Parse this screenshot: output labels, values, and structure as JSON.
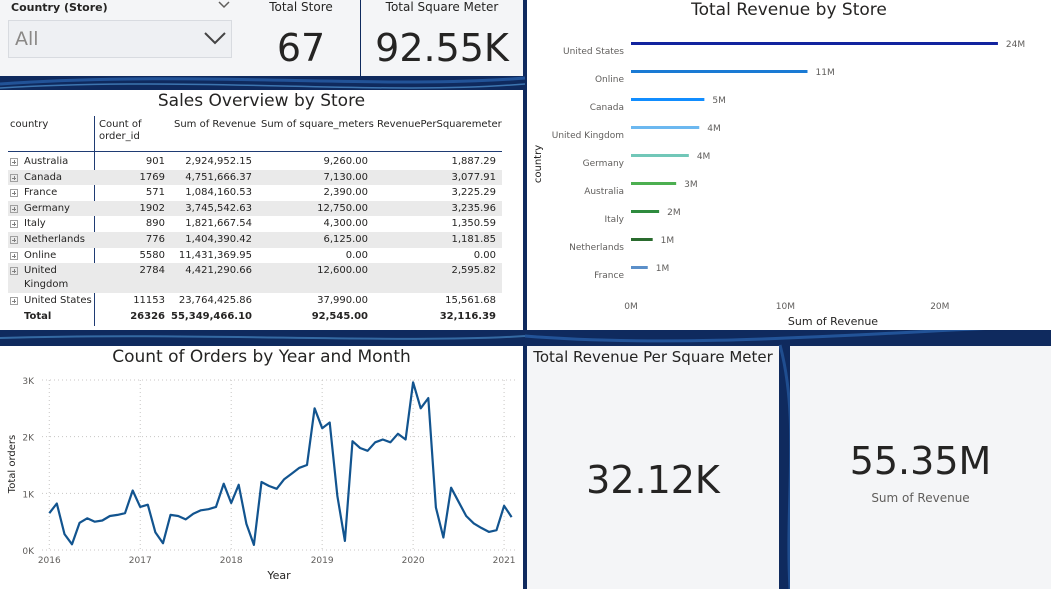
{
  "slicer": {
    "title": "Country (Store)",
    "value": "All"
  },
  "cards": {
    "total_store": {
      "title": "Total Store",
      "value": "67"
    },
    "total_square_meter": {
      "title": "Total Square Meter",
      "value": "92.55K"
    },
    "revenue_per_sqm": {
      "title": "Total Revenue Per Square Meter",
      "value": "32.12K"
    },
    "sum_revenue": {
      "value": "55.35M",
      "label": "Sum of Revenue"
    }
  },
  "table": {
    "title": "Sales Overview by Store",
    "headers": [
      "country",
      "Count of order_id",
      "Sum of Revenue",
      "Sum of square_meters",
      "RevenuePerSquaremeter"
    ],
    "header_lines": {
      "country": "country",
      "count1": "Count of",
      "count2": "order_id",
      "revenue": "Sum of Revenue",
      "sqm": "Sum of square_meters",
      "rpsm": "RevenuePerSquaremeter"
    },
    "rows": [
      {
        "country": "Australia",
        "count": "901",
        "revenue": "2,924,952.15",
        "sqm": "9,260.00",
        "rpsm": "1,887.29"
      },
      {
        "country": "Canada",
        "count": "1769",
        "revenue": "4,751,666.37",
        "sqm": "7,130.00",
        "rpsm": "3,077.91"
      },
      {
        "country": "France",
        "count": "571",
        "revenue": "1,084,160.53",
        "sqm": "2,390.00",
        "rpsm": "3,225.29"
      },
      {
        "country": "Germany",
        "count": "1902",
        "revenue": "3,745,542.63",
        "sqm": "12,750.00",
        "rpsm": "3,235.96"
      },
      {
        "country": "Italy",
        "count": "890",
        "revenue": "1,821,667.54",
        "sqm": "4,300.00",
        "rpsm": "1,350.59"
      },
      {
        "country": "Netherlands",
        "count": "776",
        "revenue": "1,404,390.42",
        "sqm": "6,125.00",
        "rpsm": "1,181.85"
      },
      {
        "country": "Online",
        "count": "5580",
        "revenue": "11,431,369.95",
        "sqm": "0.00",
        "rpsm": "0.00"
      },
      {
        "country": "United",
        "country2": "Kingdom",
        "count": "2784",
        "revenue": "4,421,290.66",
        "sqm": "12,600.00",
        "rpsm": "2,595.82"
      },
      {
        "country": "United States",
        "count": "11153",
        "revenue": "23,764,425.86",
        "sqm": "37,990.00",
        "rpsm": "15,561.68"
      }
    ],
    "total": {
      "label": "Total",
      "count": "26326",
      "revenue": "55,349,466.10",
      "sqm": "92,545.00",
      "rpsm": "32,116.39"
    }
  },
  "chart_data": [
    {
      "type": "bar",
      "orientation": "horizontal",
      "title": "Total Revenue by Store",
      "xlabel": "Sum of Revenue",
      "ylabel": "country",
      "xlim": [
        0,
        25000000
      ],
      "x_ticks": [
        "0M",
        "10M",
        "20M"
      ],
      "x_tick_values": [
        0,
        10000000,
        20000000
      ],
      "categories": [
        "United States",
        "Online",
        "Canada",
        "United Kingdom",
        "Germany",
        "Australia",
        "Italy",
        "Netherlands",
        "France"
      ],
      "values": [
        23764425.86,
        11431369.95,
        4751666.37,
        4421290.66,
        3745542.63,
        2924952.15,
        1821667.54,
        1404390.42,
        1084160.53
      ],
      "data_labels": [
        "24M",
        "11M",
        "5M",
        "4M",
        "4M",
        "3M",
        "2M",
        "1M",
        "1M"
      ],
      "colors": [
        "#12239e",
        "#1a7ad4",
        "#118dff",
        "#6cb8f0",
        "#71c7b8",
        "#4caf50",
        "#2e8b3e",
        "#2a6b2e",
        "#5b8fc9"
      ],
      "grid": false
    },
    {
      "type": "line",
      "title": "Count of Orders by Year and Month",
      "xlabel": "Year",
      "ylabel": "Total orders",
      "ylim": [
        0,
        3000
      ],
      "y_ticks": [
        "0K",
        "1K",
        "2K",
        "3K"
      ],
      "y_tick_values": [
        0,
        1000,
        2000,
        3000
      ],
      "x_ticks": [
        "2016",
        "2017",
        "2018",
        "2019",
        "2020",
        "2021"
      ],
      "x_tick_values": [
        2016,
        2017,
        2018,
        2019,
        2020,
        2021
      ],
      "xlim": [
        2015.92,
        2021.12
      ],
      "grid": true,
      "color": "#12548f",
      "x": [
        2016.0,
        2016.083,
        2016.167,
        2016.25,
        2016.333,
        2016.417,
        2016.5,
        2016.583,
        2016.667,
        2016.75,
        2016.833,
        2016.917,
        2017.0,
        2017.083,
        2017.167,
        2017.25,
        2017.333,
        2017.417,
        2017.5,
        2017.583,
        2017.667,
        2017.75,
        2017.833,
        2017.917,
        2018.0,
        2018.083,
        2018.167,
        2018.25,
        2018.333,
        2018.417,
        2018.5,
        2018.583,
        2018.667,
        2018.75,
        2018.833,
        2018.917,
        2019.0,
        2019.083,
        2019.167,
        2019.25,
        2019.333,
        2019.417,
        2019.5,
        2019.583,
        2019.667,
        2019.75,
        2019.833,
        2019.917,
        2020.0,
        2020.083,
        2020.167,
        2020.25,
        2020.333,
        2020.417,
        2020.5,
        2020.583,
        2020.667,
        2020.75,
        2020.833,
        2020.917,
        2021.0,
        2021.083
      ],
      "values": [
        650,
        820,
        280,
        100,
        480,
        560,
        500,
        520,
        600,
        620,
        650,
        1050,
        760,
        800,
        310,
        120,
        620,
        600,
        540,
        640,
        700,
        720,
        760,
        1170,
        830,
        1150,
        460,
        90,
        1200,
        1130,
        1080,
        1250,
        1350,
        1450,
        1500,
        2500,
        2150,
        2250,
        950,
        160,
        1920,
        1800,
        1750,
        1900,
        1950,
        1900,
        2050,
        1950,
        2960,
        2500,
        2680,
        750,
        220,
        1100,
        850,
        600,
        470,
        390,
        320,
        350,
        780,
        580
      ]
    }
  ]
}
